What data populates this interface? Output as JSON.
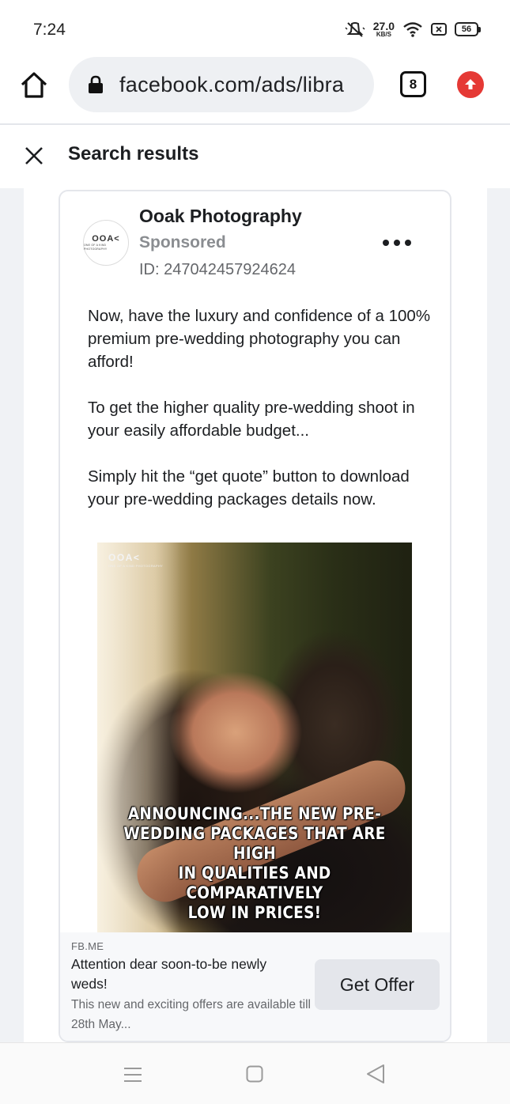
{
  "status_bar": {
    "time": "7:24",
    "net_speed_value": "27.0",
    "net_speed_unit": "KB/S",
    "battery": "56",
    "icons": [
      "mute-icon",
      "wifi-icon",
      "sim-icon",
      "battery-icon"
    ]
  },
  "browser": {
    "url": "facebook.com/ads/libra",
    "tab_count": "8",
    "icons": [
      "home-icon",
      "lock-icon",
      "tabs-icon",
      "update-icon"
    ],
    "accent_color": "#e53935"
  },
  "results_header": {
    "title": "Search results",
    "close_icon": "close-icon"
  },
  "ad": {
    "page_name": "Ooak Photography",
    "sponsored_label": "Sponsored",
    "ad_id": "ID: 247042457924624",
    "avatar_logo": "OOA<",
    "avatar_sub": "ONE OF A KIND PHOTOGRAPHY",
    "body": [
      "Now, have the luxury and confidence of a 100% premium pre-wedding photography you can afford!",
      "To get the higher quality pre-wedding shoot in your easily affordable budget...",
      "Simply hit the “get quote” button to download your pre-wedding packages details now."
    ],
    "image": {
      "logo": "OOA<",
      "logo_sub": "ONE OF A KIND PHOTOGRAPHY",
      "caption_lines": [
        "ANNOUNCING...THE NEW PRE-",
        "WEDDING PACKAGES THAT ARE HIGH",
        "IN QUALITIES AND COMPARATIVELY",
        "LOW IN PRICES!"
      ]
    },
    "cta": {
      "domain": "FB.ME",
      "headline": "Attention dear soon-to-be newly weds!",
      "description": "This new and exciting offers are available till 28th May...",
      "button_label": "Get Offer"
    }
  },
  "nav_bar": {
    "icons": [
      "menu-icon",
      "home-square-icon",
      "back-triangle-icon"
    ]
  }
}
